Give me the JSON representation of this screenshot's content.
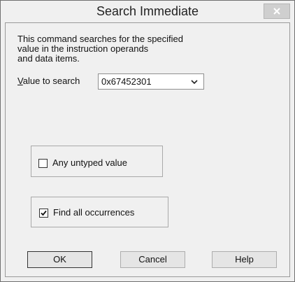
{
  "window": {
    "title": "Search Immediate",
    "close_label": "×"
  },
  "description": {
    "lines": [
      "This command searches for the specified",
      "value in the instruction operands",
      "and data items."
    ]
  },
  "search": {
    "label_underlined": "V",
    "label_rest": "alue to search",
    "value": "0x67452301"
  },
  "options": {
    "any_untyped": {
      "label": "Any untyped value",
      "checked": false
    },
    "find_all": {
      "label": "Find all occurrences",
      "checked": true
    }
  },
  "buttons": {
    "ok": "OK",
    "cancel": "Cancel",
    "help": "Help"
  },
  "icons": {
    "close": "close-icon",
    "combo": "chevron-down-icon",
    "checkmark": "check-icon"
  }
}
